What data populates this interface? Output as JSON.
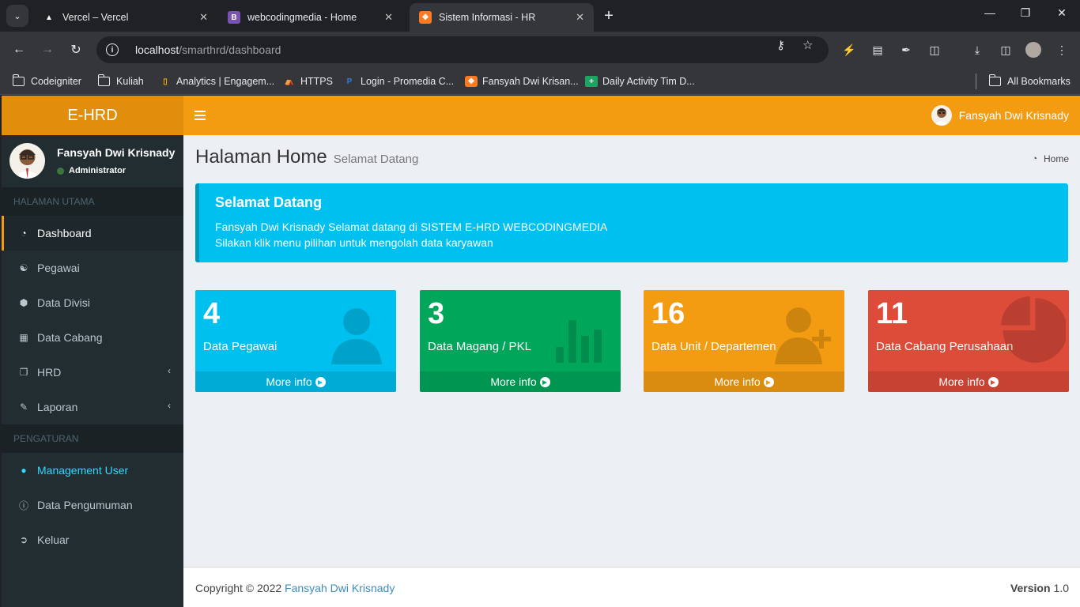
{
  "browser": {
    "tabs": [
      {
        "title": "Vercel – Vercel",
        "favicon": "vercel-icon"
      },
      {
        "title": "webcodingmedia - Home",
        "favicon": "bootstrap-icon"
      },
      {
        "title": "Sistem Informasi - HR",
        "favicon": "xampp-icon",
        "active": true
      }
    ],
    "url_host": "localhost",
    "url_path": "/smarthrd/dashboard",
    "bookmarks": [
      {
        "label": "Codeigniter"
      },
      {
        "label": "Kuliah"
      },
      {
        "label": "Analytics | Engagem..."
      },
      {
        "label": "HTTPS"
      },
      {
        "label": "Login - Promedia C..."
      },
      {
        "label": "Fansyah Dwi Krisan..."
      },
      {
        "label": "Daily Activity Tim D..."
      }
    ],
    "all_bookmarks": "All Bookmarks"
  },
  "app": {
    "logo": "E-HRD",
    "user_name": "Fansyah Dwi Krisnady",
    "user_role": "Administrator"
  },
  "sidebar": {
    "section_main": "HALAMAN UTAMA",
    "section_settings": "PENGATURAN",
    "main_items": [
      {
        "label": "Dashboard",
        "icon": "dashboard-icon"
      },
      {
        "label": "Pegawai",
        "icon": "users-icon"
      },
      {
        "label": "Data Divisi",
        "icon": "cube-icon"
      },
      {
        "label": "Data Cabang",
        "icon": "building-icon"
      },
      {
        "label": "HRD",
        "icon": "copy-icon"
      },
      {
        "label": "Laporan",
        "icon": "edit-icon"
      }
    ],
    "settings_items": [
      {
        "label": "Management User",
        "icon": "user-icon"
      },
      {
        "label": "Data Pengumuman",
        "icon": "info-icon"
      },
      {
        "label": "Keluar",
        "icon": "sign-out-icon"
      }
    ]
  },
  "page": {
    "title": "Halaman Home",
    "subtitle": "Selamat Datang",
    "breadcrumb": "Home"
  },
  "callout": {
    "title": "Selamat Datang",
    "line1": "Fansyah Dwi Krisnady Selamat datang di SISTEM E-HRD WEBCODINGMEDIA",
    "line2": "Silakan klik menu pilihan untuk mengolah data karyawan"
  },
  "stats": [
    {
      "value": "4",
      "label": "Data Pegawai",
      "more": "More info",
      "color": "#00c0ef",
      "icon": "person-icon"
    },
    {
      "value": "3",
      "label": "Data Magang / PKL",
      "more": "More info",
      "color": "#00a65a",
      "icon": "bar-chart-icon"
    },
    {
      "value": "16",
      "label": "Data Unit / Departemen",
      "more": "More info",
      "color": "#f39c12",
      "icon": "user-plus-icon"
    },
    {
      "value": "11",
      "label": "Data Cabang Perusahaan",
      "more": "More info",
      "color": "#dd4b39",
      "icon": "pie-chart-icon"
    }
  ],
  "footer": {
    "copyright": "Copyright © 2022",
    "author": "Fansyah Dwi Krisnady",
    "version_label": "Version",
    "version_value": "1.0"
  }
}
